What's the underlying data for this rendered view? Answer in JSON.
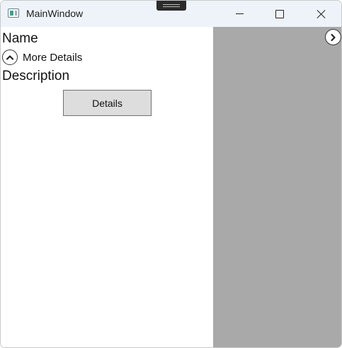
{
  "window": {
    "title": "MainWindow"
  },
  "icons": {
    "app": "window-app-icon",
    "minimize": "minimize-icon",
    "maximize": "maximize-icon",
    "close": "close-icon",
    "expander": "chevron-up-icon",
    "panel_toggle": "chevron-right-icon"
  },
  "main": {
    "name_label": "Name",
    "expander_label": "More Details",
    "description_label": "Description",
    "details_button": "Details"
  },
  "colors": {
    "titlebar": "#eef3fa",
    "side_panel": "#a9a9a9",
    "button_face": "#dddddd"
  }
}
